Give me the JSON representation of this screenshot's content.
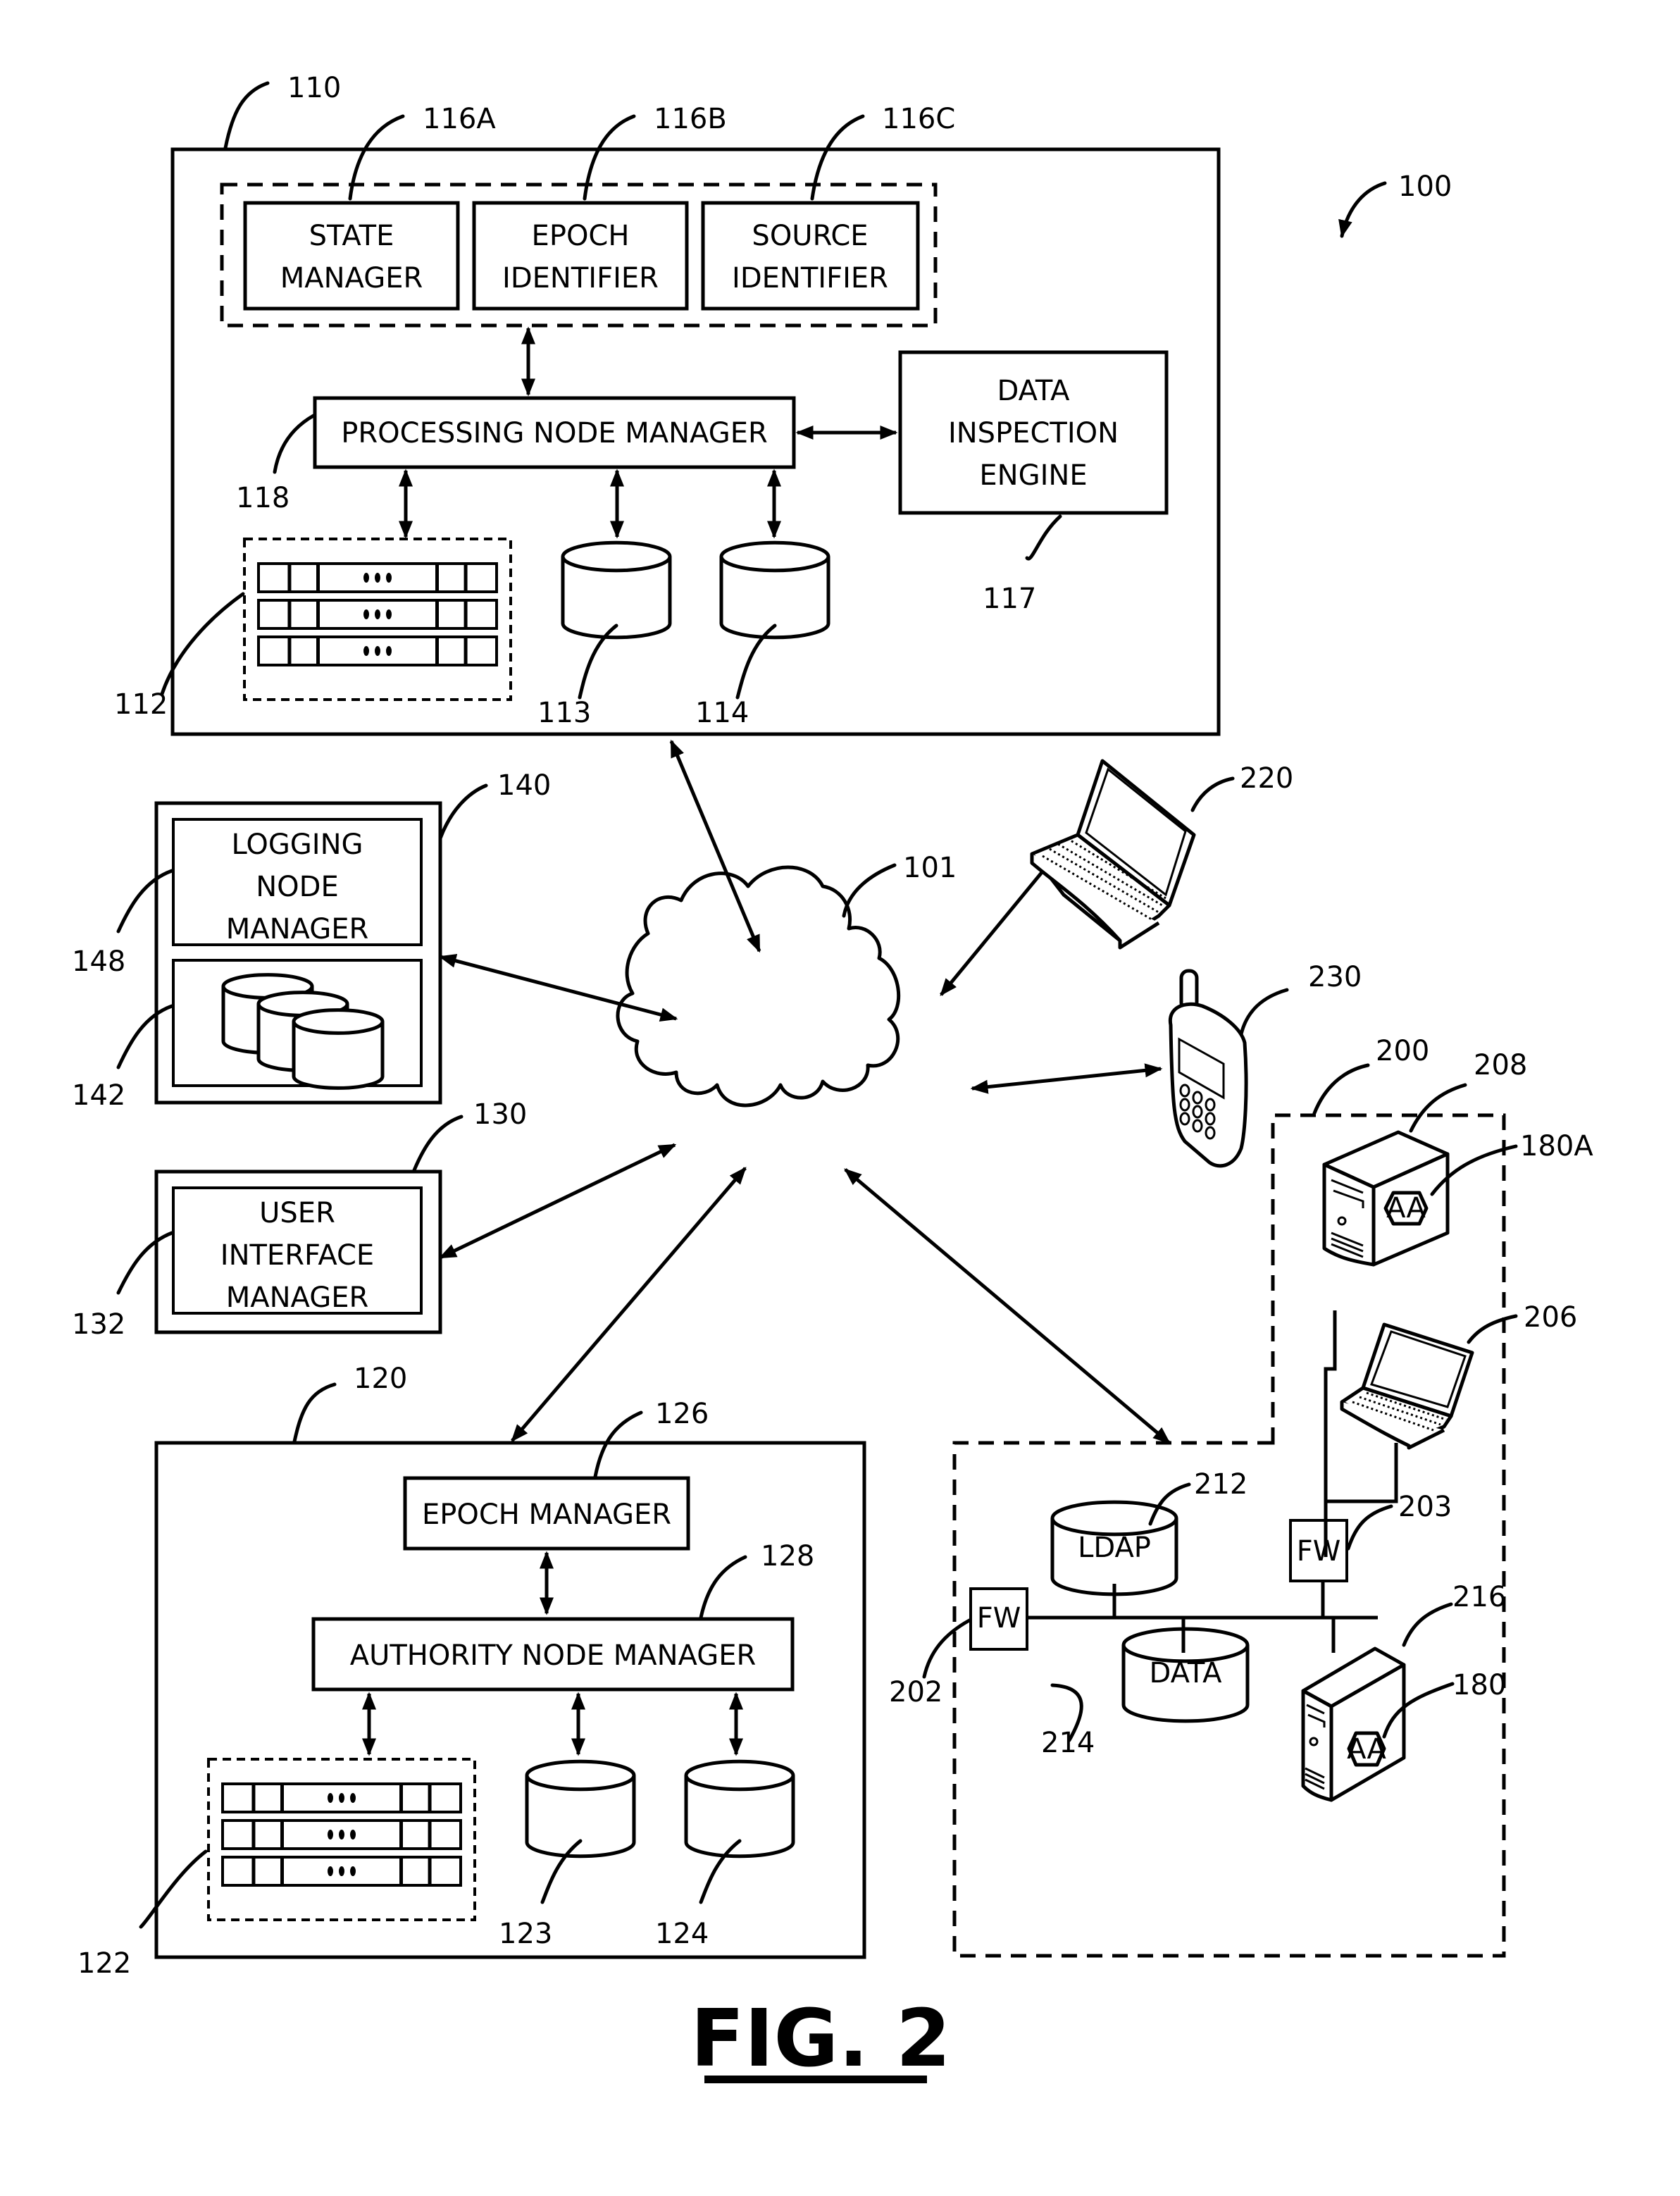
{
  "figure": {
    "title": "FIG. 2",
    "system_ref": "100"
  },
  "network": {
    "ref": "101",
    "icon": "cloud-icon"
  },
  "processing_node": {
    "ref": "110",
    "modules_group": [
      {
        "ref": "116A",
        "lines": [
          "STATE",
          "MANAGER"
        ]
      },
      {
        "ref": "116B",
        "lines": [
          "EPOCH",
          "IDENTIFIER"
        ]
      },
      {
        "ref": "116C",
        "lines": [
          "SOURCE",
          "IDENTIFIER"
        ]
      }
    ],
    "manager": {
      "ref": "118",
      "label": "PROCESSING NODE MANAGER"
    },
    "inspection_engine": {
      "ref": "117",
      "lines": [
        "DATA",
        "INSPECTION",
        "ENGINE"
      ]
    },
    "server_rack": {
      "ref": "112",
      "icon": "server-rack-icon"
    },
    "db1": {
      "ref": "113",
      "icon": "database-icon"
    },
    "db2": {
      "ref": "114",
      "icon": "database-icon"
    }
  },
  "logging_node": {
    "ref": "140",
    "manager": {
      "ref": "148",
      "lines": [
        "LOGGING",
        "NODE",
        "MANAGER"
      ]
    },
    "storage": {
      "ref": "142",
      "icon": "database-stack-icon"
    }
  },
  "ui_node": {
    "ref": "130",
    "manager": {
      "ref": "132",
      "lines": [
        "USER",
        "INTERFACE",
        "MANAGER"
      ]
    }
  },
  "authority_node": {
    "ref": "120",
    "epoch_manager": {
      "ref": "126",
      "label": "EPOCH MANAGER"
    },
    "manager": {
      "ref": "128",
      "label": "AUTHORITY NODE MANAGER"
    },
    "server_rack": {
      "ref": "122",
      "icon": "server-rack-icon"
    },
    "db1": {
      "ref": "123",
      "icon": "database-icon"
    },
    "db2": {
      "ref": "124",
      "icon": "database-icon"
    }
  },
  "client_devices": {
    "laptop": {
      "ref": "220",
      "icon": "laptop-icon"
    },
    "phone": {
      "ref": "230",
      "icon": "mobile-phone-icon"
    }
  },
  "customer_network": {
    "ref": "200",
    "server_top": {
      "ref": "208",
      "icon": "server-tower-icon",
      "agent": {
        "ref": "180A",
        "label": "AA"
      }
    },
    "laptop": {
      "ref": "206",
      "icon": "laptop-icon"
    },
    "firewall_upper": {
      "ref": "203",
      "label": "FW"
    },
    "firewall_left": {
      "ref": "202",
      "label": "FW"
    },
    "ldap": {
      "ref": "212",
      "label": "LDAP"
    },
    "data_store": {
      "ref": "214",
      "label": "DATA"
    },
    "server_bottom": {
      "ref": "216",
      "icon": "server-tower-icon",
      "agent": {
        "ref": "180",
        "label": "AA"
      }
    }
  }
}
